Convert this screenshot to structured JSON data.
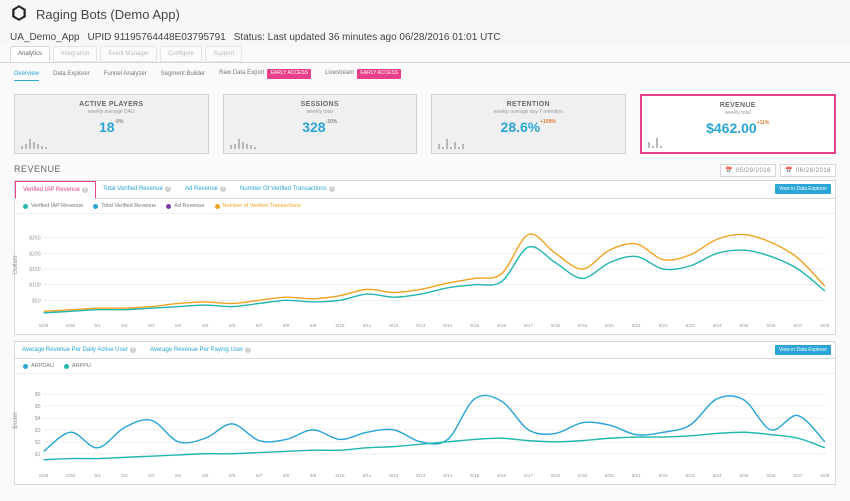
{
  "header": {
    "title": "Raging Bots (Demo App)",
    "project_label": "UA_Demo_App",
    "upid": "UPID 91195764448E03795791",
    "status": "Status: Last updated 36 minutes ago 06/28/2016 01:01 UTC"
  },
  "tabs": [
    "Analytics",
    "Integration",
    "Event Manager",
    "Configure",
    "Support"
  ],
  "subtabs": {
    "items": [
      "Overview",
      "Data Explorer",
      "Funnel Analyzer",
      "Segment Builder",
      "Raw Data Export",
      "Livestream"
    ],
    "badge": "EARLY ACCESS",
    "selected": 0
  },
  "kpis": [
    {
      "title": "ACTIVE PLAYERS",
      "subtitle": "weekly average DAU",
      "value": "18",
      "delta": "-0%",
      "spark": [
        2,
        3,
        6,
        4,
        3,
        2,
        1
      ]
    },
    {
      "title": "SESSIONS",
      "subtitle": "weekly total",
      "value": "328",
      "delta": "-10%",
      "spark": [
        3,
        4,
        8,
        6,
        4,
        3,
        2
      ]
    },
    {
      "title": "RETENTION",
      "subtitle": "weekly average day 7 retention",
      "value": "28.6%",
      "delta": "+109%",
      "spark": [
        2,
        1,
        4,
        1,
        3,
        1,
        2
      ]
    },
    {
      "title": "REVENUE",
      "subtitle": "weekly total",
      "value": "$462.00",
      "delta": "+11%",
      "spark": [
        5,
        2,
        8,
        2,
        0,
        0,
        0
      ]
    }
  ],
  "section": {
    "title": "REVENUE",
    "date_from": "05/29/2016",
    "date_to": "06/28/2016"
  },
  "chart1": {
    "tabs": [
      "Verified IAP Revenue",
      "Total Verified Revenue",
      "Ad Revenue",
      "Number Of Verified Transactions"
    ],
    "view_btn": "View in Data Explorer",
    "legend": [
      {
        "name": "Verified IAP Revenue",
        "color": "#21b6b0"
      },
      {
        "name": "Total Verified Revenue",
        "color": "#2aa5d6"
      },
      {
        "name": "Ad Revenue",
        "color": "#7a3aa8"
      },
      {
        "name": "Number of Verified Transactions",
        "color": "#f0a320"
      }
    ],
    "ylabel": "Dollars"
  },
  "chart2": {
    "tabs": [
      "Average Revenue Per Daily Active User",
      "Average Revenue Per Paying User"
    ],
    "view_btn": "View in Data Explorer",
    "legend": [
      {
        "name": "ARPDAU",
        "color": "#2aa5d6"
      },
      {
        "name": "ARPPU",
        "color": "#21b6b0"
      }
    ],
    "ylabel": "$/user"
  },
  "chart_data": [
    {
      "type": "line",
      "title": "Revenue",
      "xlabel": "",
      "ylabel": "Dollars",
      "ylim": [
        0,
        300
      ],
      "yticks": [
        50,
        100,
        150,
        200,
        250
      ],
      "x": [
        "5/29",
        "5/30",
        "6/1",
        "6/2",
        "6/3",
        "6/4",
        "6/5",
        "6/6",
        "6/7",
        "6/8",
        "6/9",
        "6/10",
        "6/11",
        "6/12",
        "6/13",
        "6/14",
        "6/15",
        "6/16",
        "6/17",
        "6/18",
        "6/19",
        "6/20",
        "6/21",
        "6/22",
        "6/23",
        "6/24",
        "6/25",
        "6/26",
        "6/27",
        "6/28"
      ],
      "series": [
        {
          "name": "Verified IAP Revenue",
          "color": "#21b6b0",
          "values": [
            10,
            15,
            20,
            20,
            25,
            30,
            35,
            30,
            40,
            50,
            45,
            50,
            70,
            60,
            70,
            90,
            100,
            110,
            220,
            170,
            120,
            170,
            190,
            150,
            160,
            200,
            210,
            190,
            150,
            80
          ]
        },
        {
          "name": "Number of Verified Transactions",
          "color": "#f0a320",
          "values": [
            15,
            20,
            25,
            25,
            30,
            40,
            45,
            40,
            50,
            60,
            55,
            65,
            85,
            75,
            85,
            105,
            120,
            135,
            260,
            200,
            150,
            210,
            230,
            180,
            195,
            245,
            260,
            235,
            185,
            95
          ]
        }
      ]
    },
    {
      "type": "line",
      "title": "Average Revenue",
      "xlabel": "",
      "ylabel": "$/user",
      "ylim": [
        0,
        7
      ],
      "yticks": [
        1,
        2,
        3,
        4,
        5,
        6
      ],
      "x": [
        "5/29",
        "5/30",
        "6/1",
        "6/2",
        "6/3",
        "6/4",
        "6/5",
        "6/6",
        "6/7",
        "6/8",
        "6/9",
        "6/10",
        "6/11",
        "6/12",
        "6/13",
        "6/14",
        "6/15",
        "6/16",
        "6/17",
        "6/18",
        "6/19",
        "6/20",
        "6/21",
        "6/22",
        "6/23",
        "6/24",
        "6/25",
        "6/26",
        "6/27",
        "6/28"
      ],
      "series": [
        {
          "name": "ARPDAU",
          "color": "#2aa5d6",
          "values": [
            1.2,
            2.8,
            1.5,
            3.2,
            3.8,
            2.0,
            2.3,
            3.5,
            2.1,
            2.2,
            3.0,
            2.2,
            2.8,
            3.0,
            2.0,
            2.2,
            5.6,
            5.4,
            3.0,
            2.7,
            3.6,
            3.4,
            2.6,
            2.8,
            3.4,
            5.6,
            5.5,
            3.0,
            4.2,
            2.0
          ]
        },
        {
          "name": "ARPPU",
          "color": "#21b6b0",
          "values": [
            0.5,
            0.6,
            0.6,
            0.7,
            0.8,
            0.9,
            1.0,
            1.0,
            1.1,
            1.2,
            1.3,
            1.3,
            1.5,
            1.6,
            1.8,
            2.0,
            2.2,
            2.3,
            2.1,
            2.0,
            2.1,
            2.3,
            2.4,
            2.4,
            2.5,
            2.7,
            2.8,
            2.6,
            2.3,
            1.5
          ]
        }
      ]
    }
  ]
}
